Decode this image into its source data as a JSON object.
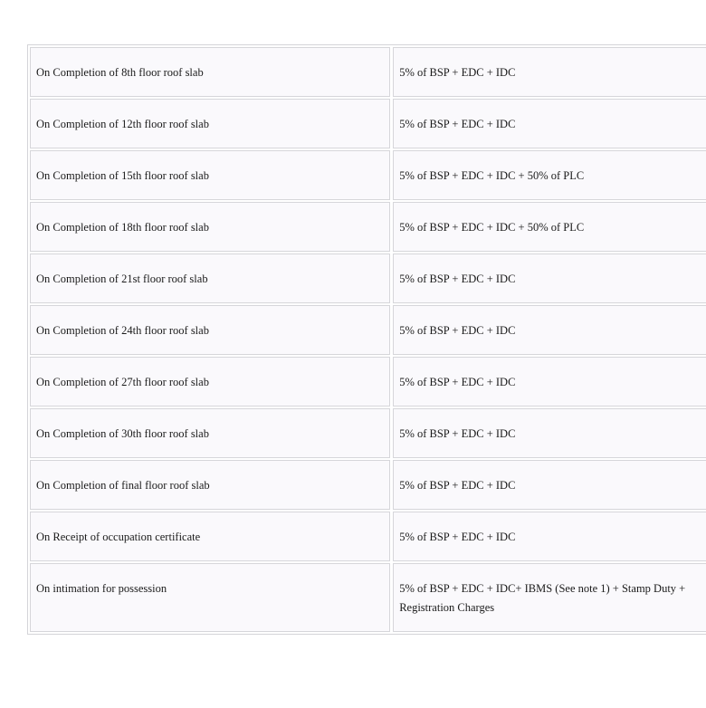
{
  "payment_plan": {
    "rows": [
      {
        "stage": "On Completion of 8th floor roof slab",
        "amount": "5% of BSP + EDC + IDC"
      },
      {
        "stage": "On Completion of 12th floor roof slab",
        "amount": "5% of BSP + EDC + IDC"
      },
      {
        "stage": "On Completion of 15th floor roof slab",
        "amount": "5% of BSP + EDC + IDC + 50% of PLC"
      },
      {
        "stage": "On Completion of 18th floor roof slab",
        "amount": "5% of BSP + EDC + IDC + 50% of PLC"
      },
      {
        "stage": "On Completion of 21st floor roof slab",
        "amount": "5% of BSP + EDC + IDC"
      },
      {
        "stage": "On Completion of 24th floor roof slab",
        "amount": "5% of BSP + EDC + IDC"
      },
      {
        "stage": "On Completion of 27th floor roof slab",
        "amount": "5% of BSP + EDC + IDC"
      },
      {
        "stage": "On Completion of 30th floor roof slab",
        "amount": "5% of BSP + EDC + IDC"
      },
      {
        "stage": "On Completion of final floor roof slab",
        "amount": "5% of BSP + EDC + IDC"
      },
      {
        "stage": "On Receipt of occupation certificate",
        "amount": "5% of BSP + EDC + IDC"
      },
      {
        "stage": "On intimation for possession",
        "amount": "5% of BSP + EDC + IDC+ IBMS (See note 1) + Stamp Duty +",
        "amount_line2": "Registration Charges"
      }
    ]
  }
}
